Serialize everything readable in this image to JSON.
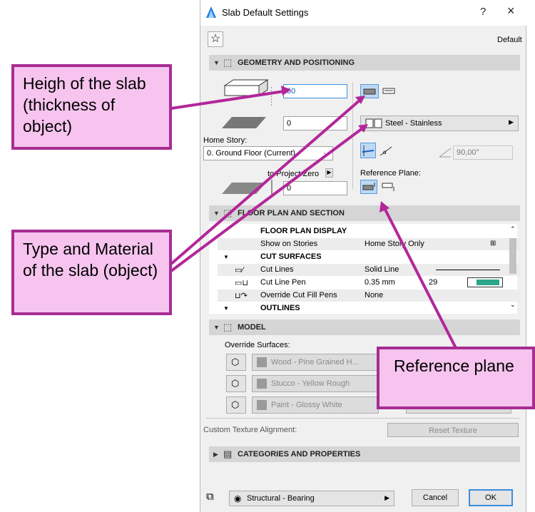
{
  "window": {
    "title": "Slab Default Settings",
    "help": "?",
    "close": "×",
    "favorite_label": "Default"
  },
  "geometry": {
    "header": "GEOMETRY AND POSITIONING",
    "thickness_value": "50",
    "offset_value": "0",
    "home_story_label": "Home Story:",
    "home_story_value": "0. Ground Floor (Current)",
    "project_zero_label": "to Project Zero",
    "project_zero_value": "0",
    "material_value": "Steel - Stainless",
    "reference_plane_label": "Reference Plane:",
    "angle_value": "90,00°"
  },
  "floor_plan": {
    "header": "FLOOR PLAN AND SECTION",
    "rows": [
      {
        "label": "FLOOR PLAN DISPLAY",
        "value": ""
      },
      {
        "label": "Show on Stories",
        "value": "Home Story Only"
      },
      {
        "label": "CUT SURFACES",
        "value": ""
      },
      {
        "label": "Cut Lines",
        "value": "Solid Line"
      },
      {
        "label": "Cut Line Pen",
        "value": "0.35 mm"
      },
      {
        "label": "Override Cut Fill Pens",
        "value": "None"
      },
      {
        "label": "OUTLINES",
        "value": ""
      }
    ],
    "pen_number": "29"
  },
  "model": {
    "header": "MODEL",
    "override_label": "Override Surfaces:",
    "surfaces": [
      "Wood - Pine Grained H...",
      "Stucco - Yellow Rough",
      "Paint - Glossy White"
    ],
    "texture_label": "Custom Texture Alignment:",
    "reset_texture": "Reset Texture"
  },
  "categories": {
    "header": "CATEGORIES AND PROPERTIES"
  },
  "footer": {
    "layer": "Structural - Bearing",
    "cancel": "Cancel",
    "ok": "OK"
  },
  "annotations": {
    "height": "Heigh of the slab (thickness of object)",
    "type": "Type and Material of the slab (object)",
    "reference": "Reference plane"
  },
  "colors": {
    "annotation_fill": "#f6c4ee",
    "annotation_border": "#a72d93",
    "arrow": "#b3269a",
    "pen_swatch": "#2aa78a"
  }
}
